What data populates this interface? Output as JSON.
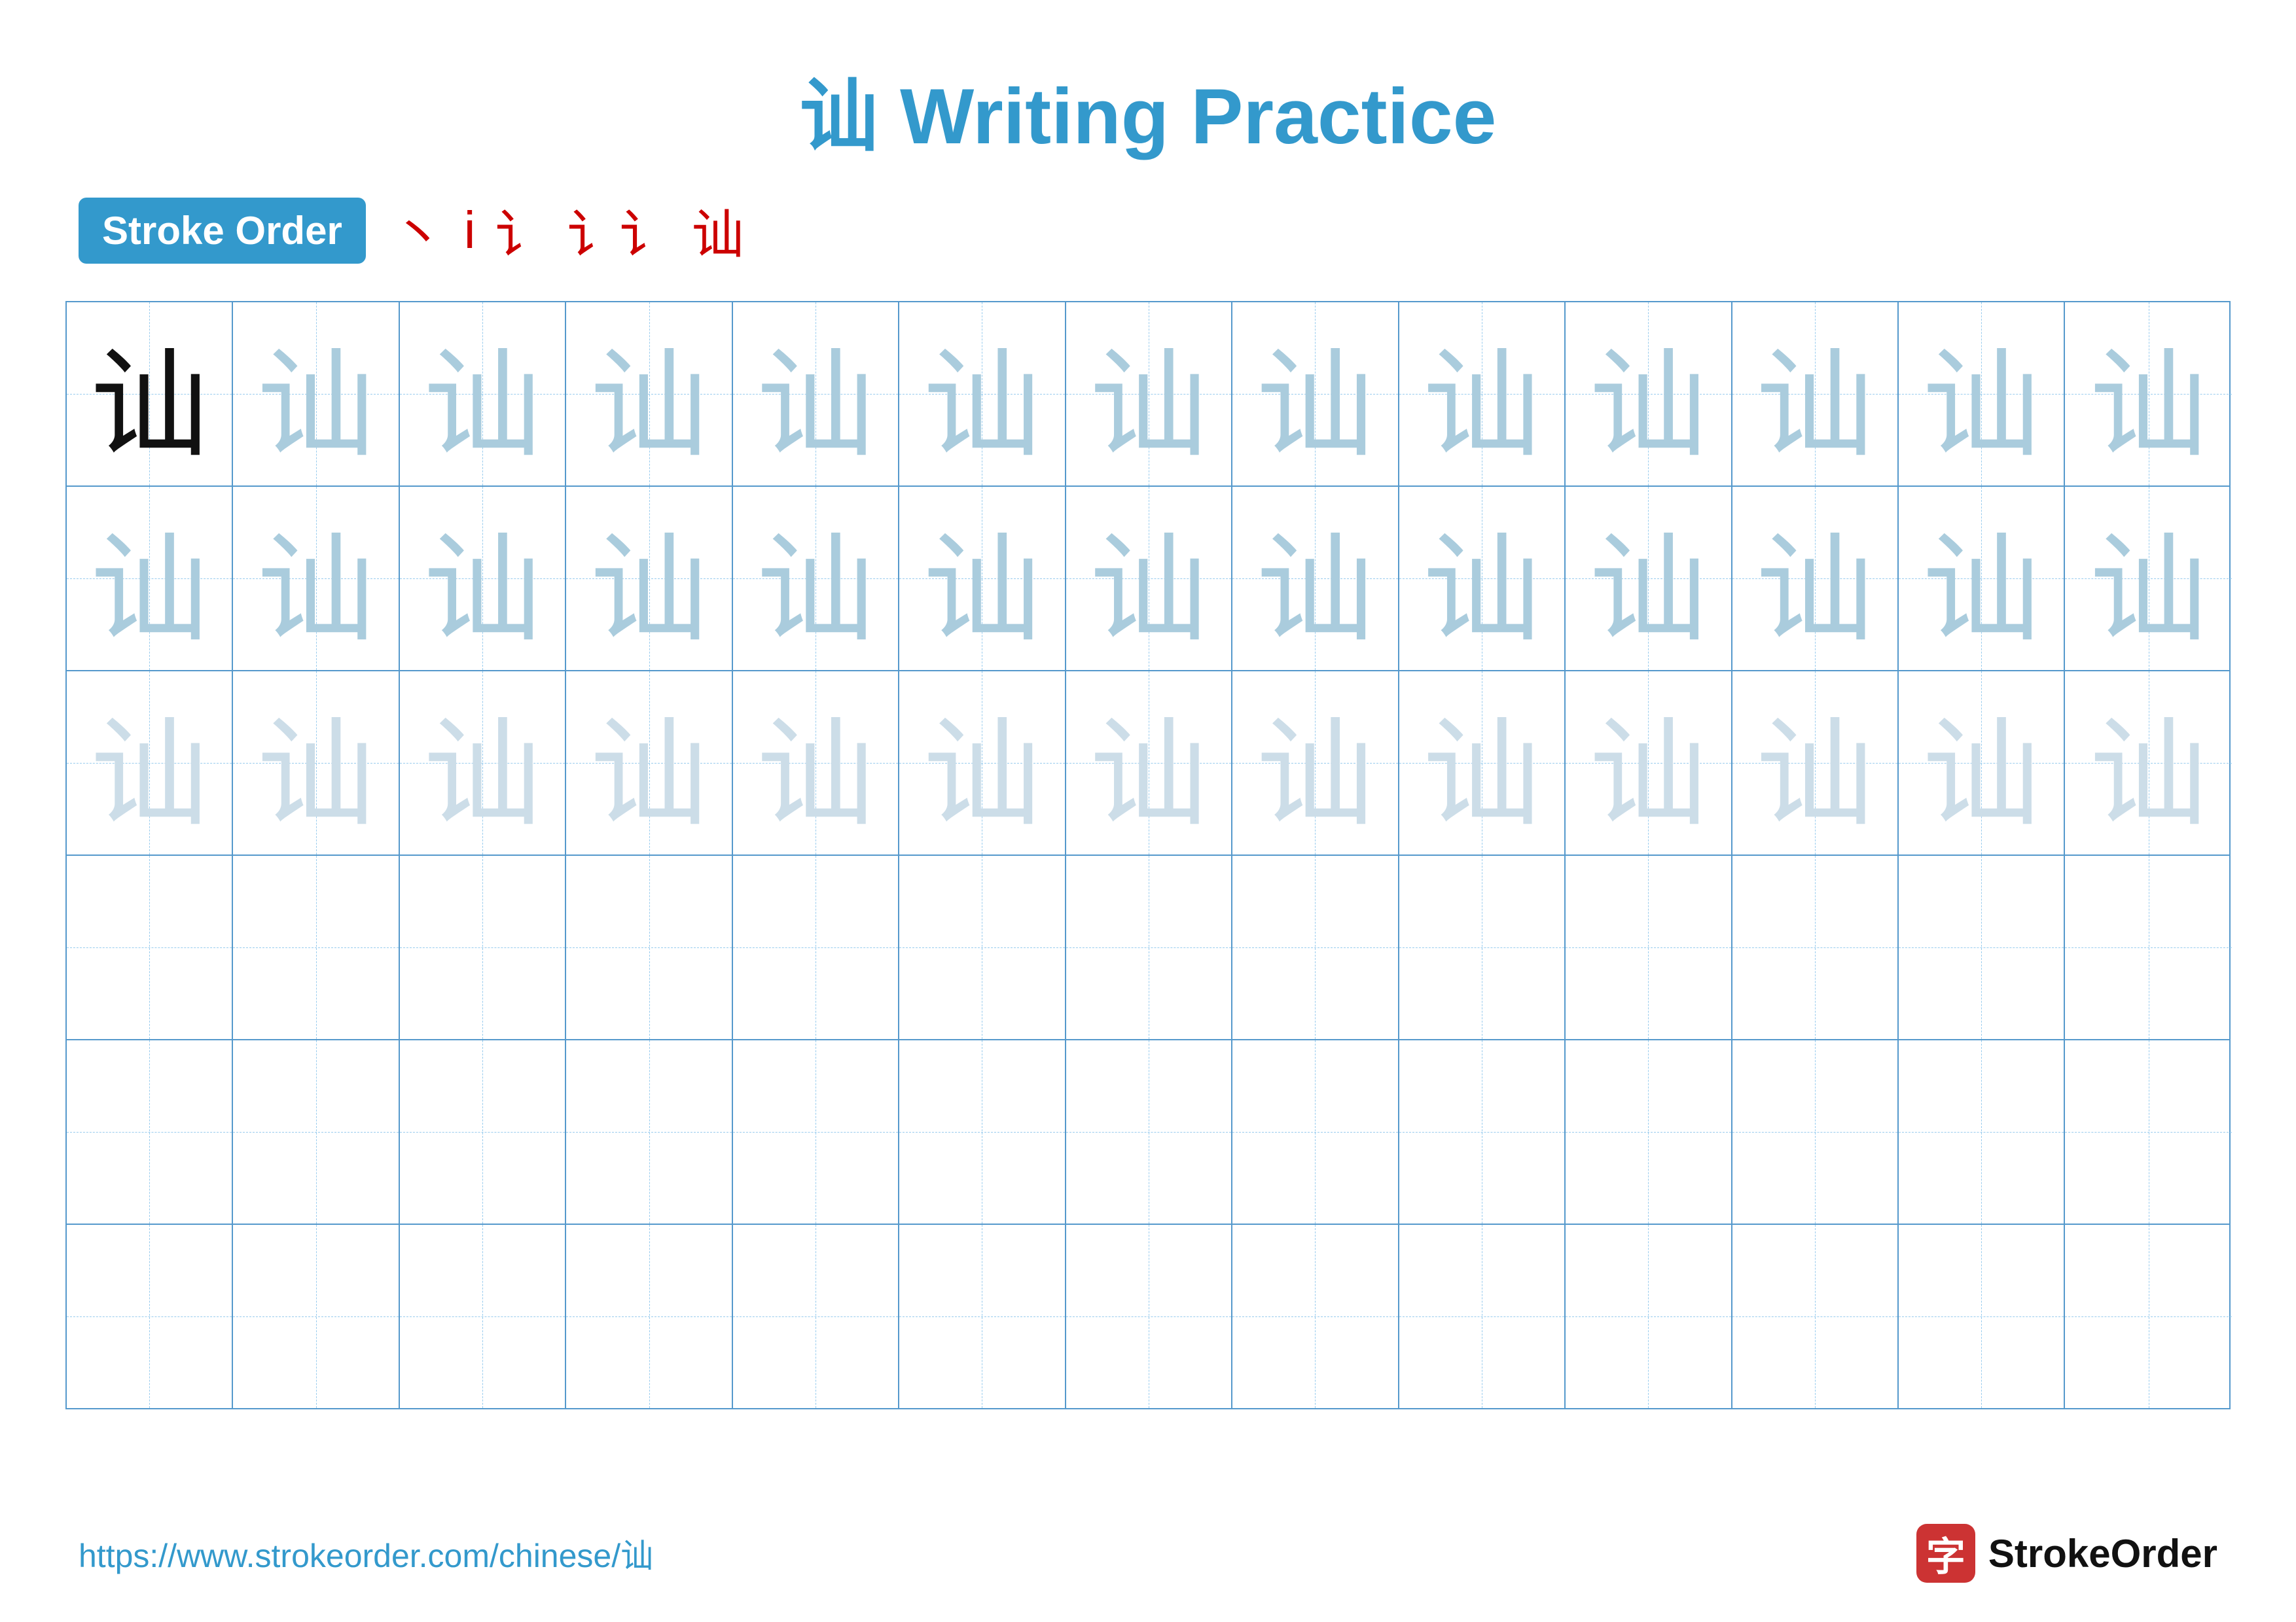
{
  "title": "讪 Writing Practice",
  "stroke_order_label": "Stroke Order",
  "stroke_sequence": [
    "丶",
    "i",
    "讠",
    "讠讠",
    "讪"
  ],
  "character": "讪",
  "rows": [
    {
      "type": "dark_then_medium",
      "dark_count": 1,
      "medium_count": 12
    },
    {
      "type": "medium",
      "count": 13
    },
    {
      "type": "light",
      "count": 13
    },
    {
      "type": "empty",
      "count": 13
    },
    {
      "type": "empty",
      "count": 13
    },
    {
      "type": "empty",
      "count": 13
    }
  ],
  "footer_url": "https://www.strokeorder.com/chinese/讪",
  "footer_logo_text": "StrokeOrder",
  "footer_logo_icon": "字"
}
